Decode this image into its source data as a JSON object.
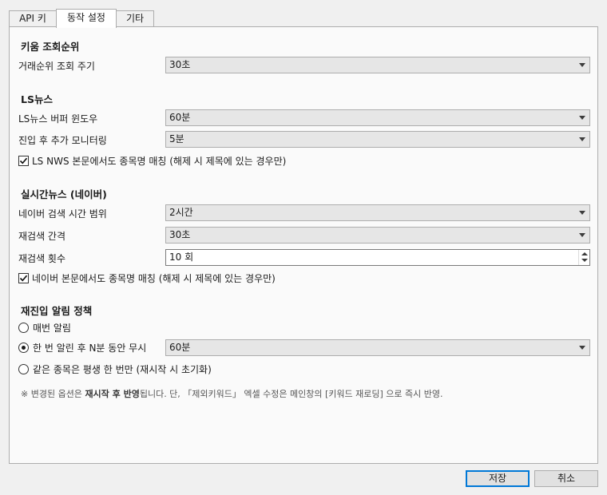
{
  "tabs": [
    {
      "label": "API 키",
      "active": false
    },
    {
      "label": "동작 설정",
      "active": true
    },
    {
      "label": "기타",
      "active": false
    }
  ],
  "sections": {
    "kiwoom": {
      "title": "키움 조회순위",
      "interval_label": "거래순위 조회 주기",
      "interval_value": "30초"
    },
    "ls_news": {
      "title": "LS뉴스",
      "buffer_label": "LS뉴스 버퍼 윈도우",
      "buffer_value": "60분",
      "monitor_label": "진입 후 추가 모니터링",
      "monitor_value": "5분",
      "body_match_label": "LS NWS 본문에서도 종목명 매칭 (해제 시 제목에 있는 경우만)",
      "body_match_checked": true
    },
    "naver": {
      "title": "실시간뉴스 (네이버)",
      "range_label": "네이버 검색 시간 범위",
      "range_value": "2시간",
      "research_interval_label": "재검색 간격",
      "research_interval_value": "30초",
      "research_count_label": "재검색 횟수",
      "research_count_value": "10 회",
      "body_match_label": "네이버 본문에서도 종목명 매칭 (해제 시 제목에 있는 경우만)",
      "body_match_checked": true
    },
    "realert": {
      "title": "재진입 알림 정책",
      "options": [
        {
          "label": "매번 알림",
          "selected": false
        },
        {
          "label": "한 번 알린 후 N분 동안 무시",
          "selected": true
        },
        {
          "label": "같은 종목은 평생 한 번만 (재시작 시 초기화)",
          "selected": false
        }
      ],
      "ignore_value": "60분"
    }
  },
  "note": {
    "prefix": "※ 변경된 옵션은 ",
    "bold": "재시작 후 반영",
    "suffix": "됩니다. 단, 「제외키워드」 엑셀 수정은 메인창의 [키워드 재로딩] 으로 즉시 반영."
  },
  "buttons": {
    "save": "저장",
    "cancel": "취소"
  }
}
